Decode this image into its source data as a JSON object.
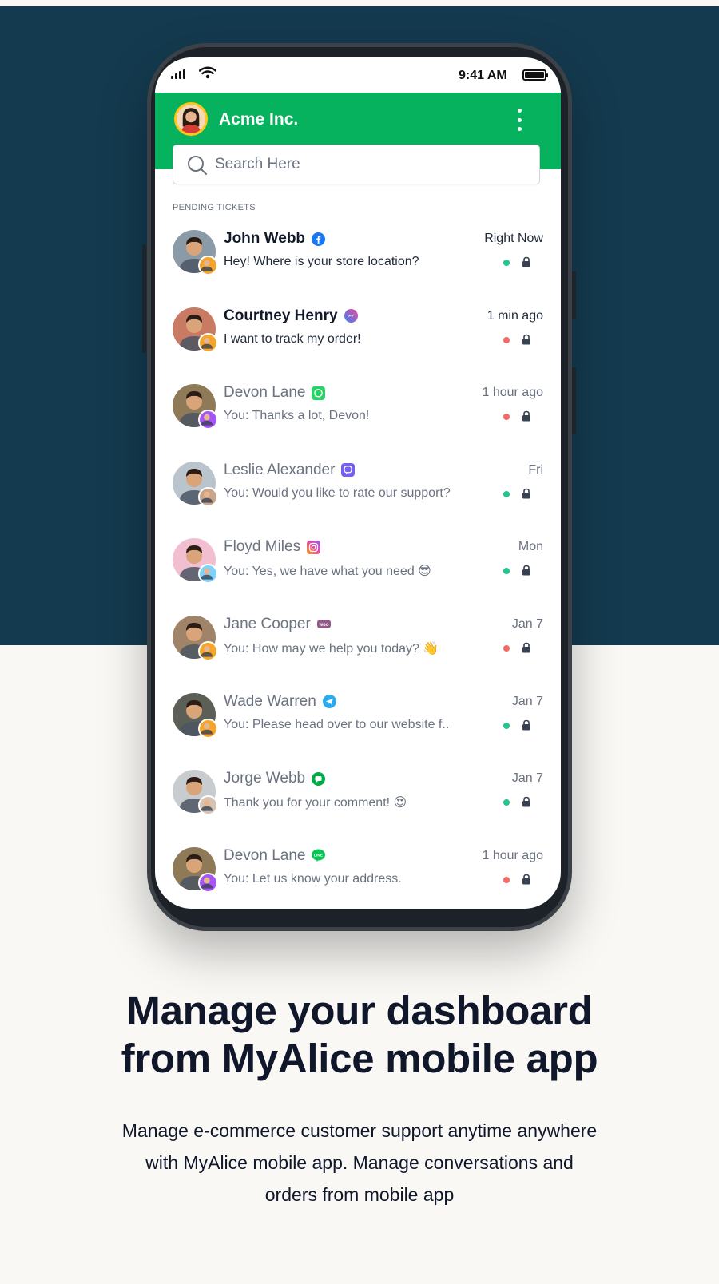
{
  "status_bar": {
    "time": "9:41 AM"
  },
  "app": {
    "title": "Acme Inc.",
    "search": {
      "placeholder": "Search Here",
      "value": ""
    },
    "section_label": "PENDING TICKETS"
  },
  "tickets": [
    {
      "name": "John Webb",
      "channel": "facebook-icon",
      "message": "Hey! Where is your store location?",
      "time": "Right Now",
      "status_color": "#22c58b",
      "unread": true,
      "avatar_color": "#8a9aa7",
      "sub_color": "#f4a52a"
    },
    {
      "name": "Courtney Henry",
      "channel": "messenger-icon",
      "message": "I want to track my order!",
      "time": "1 min ago",
      "status_color": "#f26b6b",
      "unread": true,
      "avatar_color": "#c97a63",
      "sub_color": "#f4a52a"
    },
    {
      "name": "Devon Lane",
      "channel": "whatsapp-icon",
      "message": "You: Thanks a lot, Devon!",
      "time": "1 hour ago",
      "status_color": "#f26b6b",
      "unread": false,
      "avatar_color": "#8f7a58",
      "sub_color": "#a855f7"
    },
    {
      "name": "Leslie Alexander",
      "channel": "viber-icon",
      "message": "You: Would you like to rate our support?",
      "time": "Fri",
      "status_color": "#22c58b",
      "unread": false,
      "avatar_color": "#b9c4cc",
      "sub_color": "#caa58a"
    },
    {
      "name": "Floyd Miles",
      "channel": "instagram-icon",
      "message": "You: Yes, we have what you need 😎",
      "time": "Mon",
      "status_color": "#22c58b",
      "unread": false,
      "avatar_color": "#f2bfd0",
      "sub_color": "#7dd3fc"
    },
    {
      "name": "Jane Cooper",
      "channel": "woocommerce-icon",
      "message": "You: How may we help you today? 👋",
      "time": "Jan 7",
      "status_color": "#f26b6b",
      "unread": false,
      "avatar_color": "#a08469",
      "sub_color": "#f4a52a"
    },
    {
      "name": "Wade Warren",
      "channel": "telegram-icon",
      "message": "You: Please head over to our website f..",
      "time": "Jan 7",
      "status_color": "#22c58b",
      "unread": false,
      "avatar_color": "#5b5f56",
      "sub_color": "#f4a52a"
    },
    {
      "name": "Jorge Webb",
      "channel": "google-chat-icon",
      "message": "Thank you for your comment! 😍",
      "time": "Jan 7",
      "status_color": "#22c58b",
      "unread": false,
      "avatar_color": "#c9ccce",
      "sub_color": "#d6c4b3"
    },
    {
      "name": "Devon Lane",
      "channel": "line-icon",
      "message": "You: Let us know your address.",
      "time": "1 hour ago",
      "status_color": "#f26b6b",
      "unread": false,
      "avatar_color": "#8f7a58",
      "sub_color": "#a855f7"
    }
  ],
  "marketing": {
    "headline_line1": "Manage your dashboard",
    "headline_line2": "from MyAlice mobile app",
    "body": "Manage e-commerce customer support anytime anywhere with MyAlice mobile app. Manage conversations and orders from mobile app"
  },
  "colors": {
    "hero_bg": "#143a4f",
    "header_green": "#07b25e",
    "page_bg": "#f9f8f5",
    "text_dark": "#10172a"
  }
}
